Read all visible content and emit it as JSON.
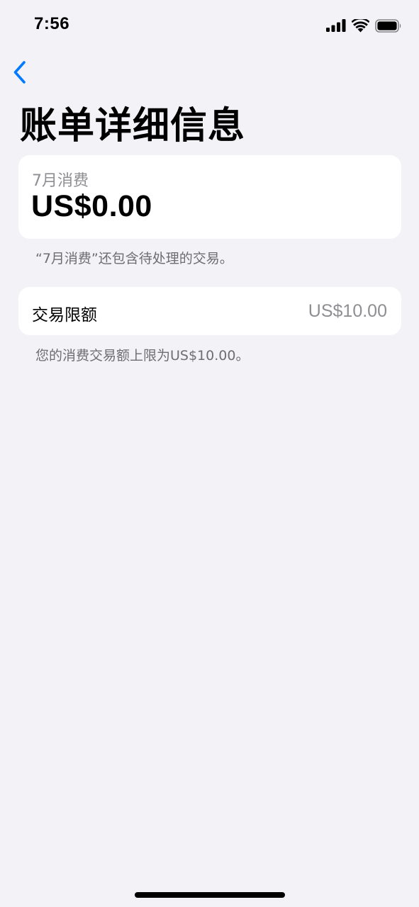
{
  "status_bar": {
    "time": "7:56",
    "icons": [
      "cellular-signal-icon",
      "wifi-icon",
      "battery-icon"
    ]
  },
  "nav": {
    "back_icon": "chevron-left-icon",
    "accent_color": "#007aff"
  },
  "page": {
    "title": "账单详细信息"
  },
  "spending": {
    "label": "7月消费",
    "amount": "US$0.00",
    "note": "“7月消费”还包含待处理的交易。"
  },
  "limit": {
    "label": "交易限额",
    "value": "US$10.00",
    "note": "您的消费交易额上限为US$10.00。"
  },
  "colors": {
    "background": "#f2f2f7",
    "card": "#ffffff",
    "secondary_text": "#8e8e93",
    "footnote_text": "#6d6d72"
  }
}
